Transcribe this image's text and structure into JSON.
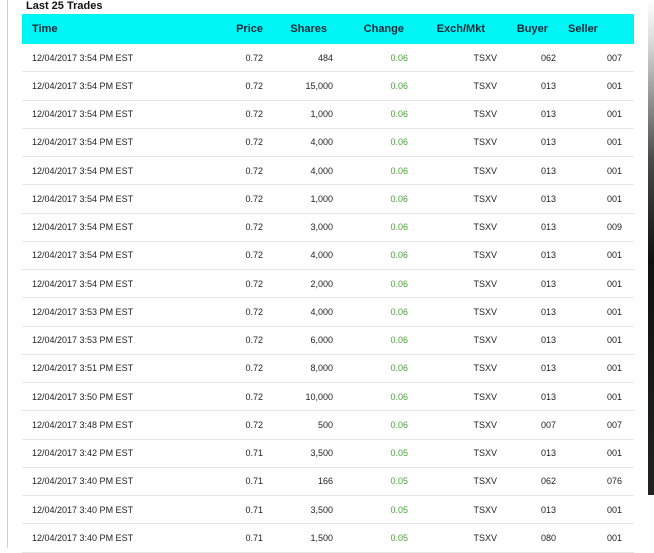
{
  "title": "Last 25 Trades",
  "colors": {
    "header_bg": "#00f5f5",
    "change_positive": "#4aa33a"
  },
  "columns": [
    "Time",
    "Price",
    "Shares",
    "Change",
    "Exch/Mkt",
    "Buyer",
    "Seller"
  ],
  "rows": [
    {
      "time": "12/04/2017 3:54 PM EST",
      "price": "0.72",
      "shares": "484",
      "change": "0.06",
      "exch": "TSXV",
      "buyer": "062",
      "seller": "007"
    },
    {
      "time": "12/04/2017 3:54 PM EST",
      "price": "0.72",
      "shares": "15,000",
      "change": "0.06",
      "exch": "TSXV",
      "buyer": "013",
      "seller": "001"
    },
    {
      "time": "12/04/2017 3:54 PM EST",
      "price": "0.72",
      "shares": "1,000",
      "change": "0.06",
      "exch": "TSXV",
      "buyer": "013",
      "seller": "001"
    },
    {
      "time": "12/04/2017 3:54 PM EST",
      "price": "0.72",
      "shares": "4,000",
      "change": "0.06",
      "exch": "TSXV",
      "buyer": "013",
      "seller": "001"
    },
    {
      "time": "12/04/2017 3:54 PM EST",
      "price": "0.72",
      "shares": "4,000",
      "change": "0.06",
      "exch": "TSXV",
      "buyer": "013",
      "seller": "001"
    },
    {
      "time": "12/04/2017 3:54 PM EST",
      "price": "0.72",
      "shares": "1,000",
      "change": "0.06",
      "exch": "TSXV",
      "buyer": "013",
      "seller": "001"
    },
    {
      "time": "12/04/2017 3:54 PM EST",
      "price": "0.72",
      "shares": "3,000",
      "change": "0.06",
      "exch": "TSXV",
      "buyer": "013",
      "seller": "009"
    },
    {
      "time": "12/04/2017 3:54 PM EST",
      "price": "0.72",
      "shares": "4,000",
      "change": "0.06",
      "exch": "TSXV",
      "buyer": "013",
      "seller": "001"
    },
    {
      "time": "12/04/2017 3:54 PM EST",
      "price": "0.72",
      "shares": "2,000",
      "change": "0.06",
      "exch": "TSXV",
      "buyer": "013",
      "seller": "001"
    },
    {
      "time": "12/04/2017 3:53 PM EST",
      "price": "0.72",
      "shares": "4,000",
      "change": "0.06",
      "exch": "TSXV",
      "buyer": "013",
      "seller": "001"
    },
    {
      "time": "12/04/2017 3:53 PM EST",
      "price": "0.72",
      "shares": "6,000",
      "change": "0.06",
      "exch": "TSXV",
      "buyer": "013",
      "seller": "001"
    },
    {
      "time": "12/04/2017 3:51 PM EST",
      "price": "0.72",
      "shares": "8,000",
      "change": "0.06",
      "exch": "TSXV",
      "buyer": "013",
      "seller": "001"
    },
    {
      "time": "12/04/2017 3:50 PM EST",
      "price": "0.72",
      "shares": "10,000",
      "change": "0.06",
      "exch": "TSXV",
      "buyer": "013",
      "seller": "001"
    },
    {
      "time": "12/04/2017 3:48 PM EST",
      "price": "0.72",
      "shares": "500",
      "change": "0.06",
      "exch": "TSXV",
      "buyer": "007",
      "seller": "007"
    },
    {
      "time": "12/04/2017 3:42 PM EST",
      "price": "0.71",
      "shares": "3,500",
      "change": "0.05",
      "exch": "TSXV",
      "buyer": "013",
      "seller": "001"
    },
    {
      "time": "12/04/2017 3:40 PM EST",
      "price": "0.71",
      "shares": "166",
      "change": "0.05",
      "exch": "TSXV",
      "buyer": "062",
      "seller": "076"
    },
    {
      "time": "12/04/2017 3:40 PM EST",
      "price": "0.71",
      "shares": "3,500",
      "change": "0.05",
      "exch": "TSXV",
      "buyer": "013",
      "seller": "001"
    },
    {
      "time": "12/04/2017 3:40 PM EST",
      "price": "0.71",
      "shares": "1,500",
      "change": "0.05",
      "exch": "TSXV",
      "buyer": "080",
      "seller": "001"
    }
  ]
}
